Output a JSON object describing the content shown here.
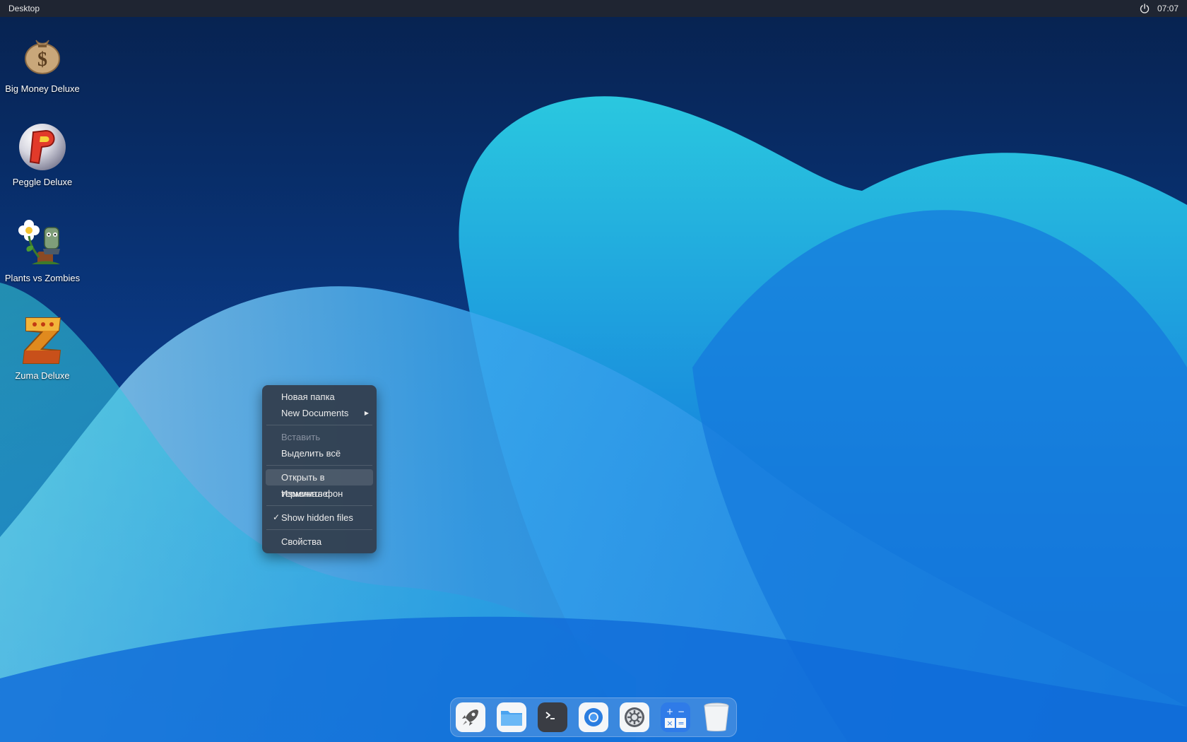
{
  "topbar": {
    "title": "Desktop",
    "clock": "07:07",
    "power_icon": "power-icon"
  },
  "desktop_icons": [
    {
      "label": "Big Money Deluxe",
      "icon": "money-bag-icon"
    },
    {
      "label": "Peggle Deluxe",
      "icon": "peggle-icon"
    },
    {
      "label": "Plants vs Zombies",
      "icon": "plants-vs-zombies-icon"
    },
    {
      "label": "Zuma Deluxe",
      "icon": "zuma-icon"
    }
  ],
  "context_menu": {
    "new_folder": "Новая папка",
    "new_documents": "New Documents",
    "paste": "Вставить",
    "select_all": "Выделить всё",
    "open_terminal": "Открыть в терминале",
    "change_wallpaper": "Изменить фон",
    "show_hidden_check": "✓",
    "show_hidden": "Show hidden files",
    "properties": "Свойства"
  },
  "dock": [
    {
      "icon": "launcher-rocket-icon"
    },
    {
      "icon": "file-manager-icon"
    },
    {
      "icon": "terminal-icon"
    },
    {
      "icon": "browser-icon"
    },
    {
      "icon": "settings-icon"
    },
    {
      "icon": "calculator-icon"
    },
    {
      "icon": "trash-icon"
    }
  ],
  "colors": {
    "wallpaper_dark": "#062152",
    "wallpaper_cyan": "#27c6e0",
    "wallpaper_blue": "#1a6fd6"
  }
}
